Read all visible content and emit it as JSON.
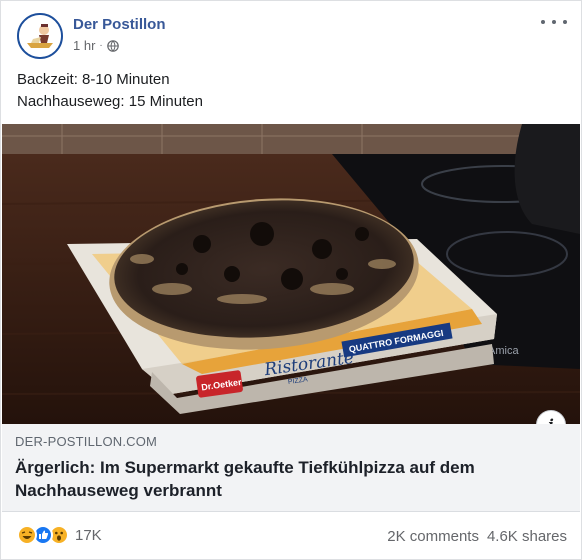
{
  "post": {
    "page_name": "Der Postillon",
    "time": "1 hr",
    "privacy_icon": "globe-icon",
    "text_lines": [
      "Backzeit: 8-10 Minuten",
      "Nachhauseweg: 15 Minuten"
    ]
  },
  "image": {
    "box_brand": "Dr.Oetker",
    "box_product": "Ristorante",
    "box_subtitle": "PIZZA",
    "box_flavor": "QUATTRO FORMAGGI",
    "stove_brand": "Amica"
  },
  "link": {
    "domain": "DER-POSTILLON.COM",
    "title": "Ärgerlich: Im Supermarkt gekaufte Tiefkühlpizza auf dem Nachhauseweg verbrannt"
  },
  "footer": {
    "reaction_icons": [
      "haha-icon",
      "like-icon",
      "wow-icon"
    ],
    "reaction_count": "17K",
    "comments": "2K comments",
    "shares": "4.6K shares"
  },
  "colors": {
    "link_blue": "#385898",
    "like_blue": "#1877f2",
    "reaction_yellow": "#f7b125"
  }
}
